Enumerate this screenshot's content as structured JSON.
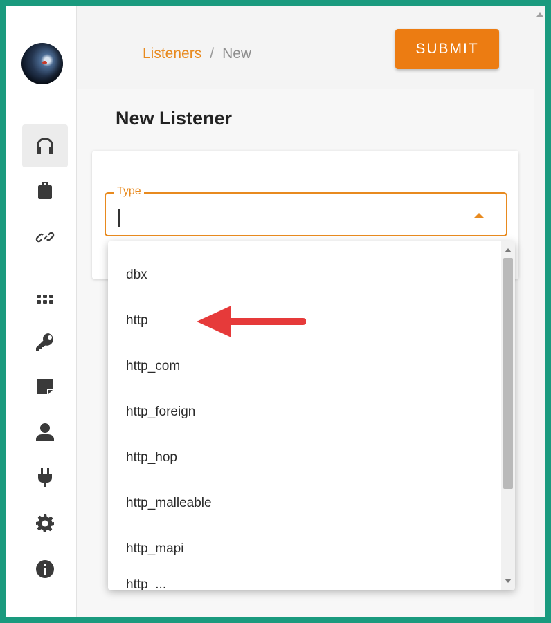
{
  "breadcrumb": {
    "link": "Listeners",
    "separator": "/",
    "current": "New"
  },
  "actions": {
    "submit_label": "SUBMIT"
  },
  "page": {
    "title": "New Listener"
  },
  "form": {
    "type_label": "Type",
    "type_value": ""
  },
  "dropdown": {
    "options": [
      "dbx",
      "http",
      "http_com",
      "http_foreign",
      "http_hop",
      "http_malleable",
      "http_mapi"
    ],
    "partially_visible_next": "http_..."
  },
  "sidebar": {
    "avatar": "avatar",
    "items": [
      {
        "icon": "headphones-icon",
        "active": true
      },
      {
        "icon": "briefcase-icon",
        "active": false
      },
      {
        "icon": "link-icon",
        "active": false
      },
      {
        "icon": "grid-icon",
        "active": false
      },
      {
        "icon": "key-icon",
        "active": false
      },
      {
        "icon": "note-icon",
        "active": false
      },
      {
        "icon": "user-icon",
        "active": false
      },
      {
        "icon": "plug-icon",
        "active": false
      },
      {
        "icon": "gear-icon",
        "active": false
      },
      {
        "icon": "info-icon",
        "active": false
      }
    ]
  },
  "annotation": {
    "arrow_color": "#e63a3a",
    "points_to": "http"
  },
  "colors": {
    "accent": "#ec7c12",
    "frame": "#1a9a7e",
    "annotation": "#e63a3a"
  }
}
